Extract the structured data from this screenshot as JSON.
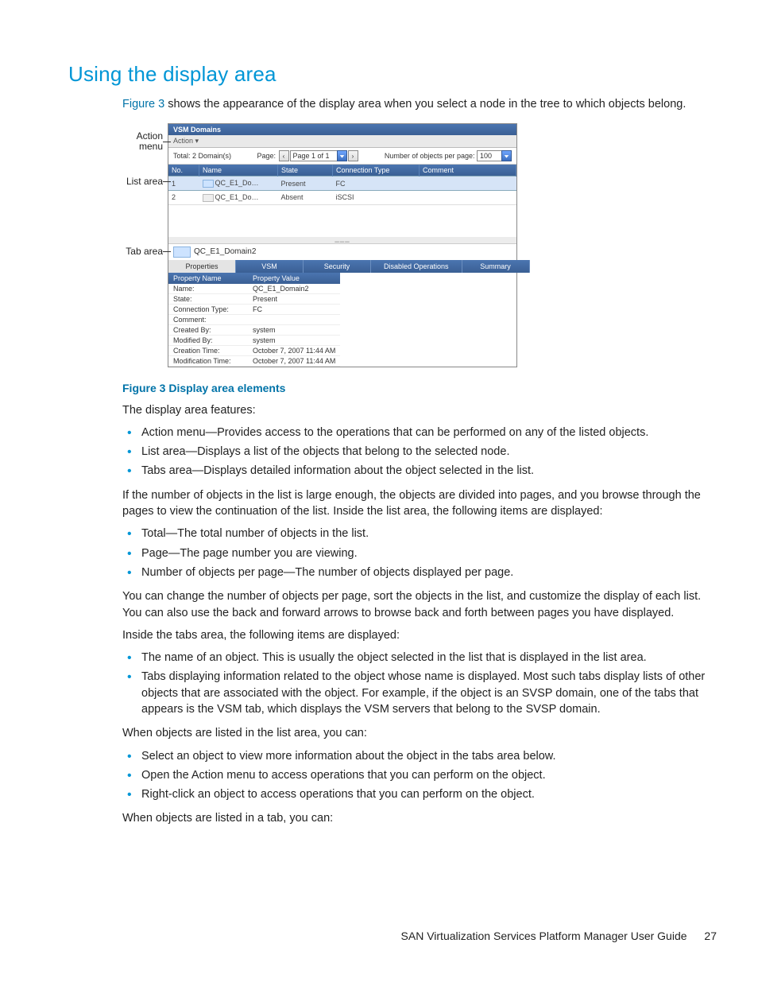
{
  "section_title": "Using the display area",
  "intro_prefix": "Figure 3",
  "intro_rest": " shows the appearance of the display area when you select a node in the tree to which objects belong.",
  "callouts": {
    "action": "Action menu",
    "list": "List area",
    "tab": "Tab area"
  },
  "screenshot": {
    "title": "VSM Domains",
    "action_label": "Action ▾",
    "total_label": "Total: 2 Domain(s)",
    "page_label": "Page:",
    "page_value": "Page 1 of 1",
    "perpage_label": "Number of objects per page:",
    "perpage_value": "100",
    "columns": [
      "No.",
      "Name",
      "State",
      "Connection Type",
      "Comment"
    ],
    "rows": [
      {
        "no": "1",
        "name": "QC_E1_Do…",
        "state": "Present",
        "conn": "FC",
        "comment": ""
      },
      {
        "no": "2",
        "name": "QC_E1_Do…",
        "state": "Absent",
        "conn": "iSCSI",
        "comment": ""
      }
    ],
    "detail_name": "QC_E1_Domain2",
    "tabs": [
      "Properties",
      "VSM",
      "Security",
      "Disabled Operations",
      "Summary"
    ],
    "prop_headers": [
      "Property Name",
      "Property Value"
    ],
    "properties": [
      {
        "k": "Name:",
        "v": "QC_E1_Domain2"
      },
      {
        "k": "State:",
        "v": "Present"
      },
      {
        "k": "Connection Type:",
        "v": "FC"
      },
      {
        "k": "Comment:",
        "v": ""
      },
      {
        "k": "Created By:",
        "v": "system"
      },
      {
        "k": "Modified By:",
        "v": "system"
      },
      {
        "k": "Creation Time:",
        "v": "October 7, 2007 11:44 AM"
      },
      {
        "k": "Modification Time:",
        "v": "October 7, 2007 11:44 AM"
      }
    ]
  },
  "figure_caption": "Figure 3 Display area elements",
  "para_features": "The display area features:",
  "feature_bullets": [
    "Action menu—Provides access to the operations that can be performed on any of the listed objects.",
    "List area—Displays a list of the objects that belong to the selected node.",
    "Tabs area—Displays detailed information about the object selected in the list."
  ],
  "para_pages": "If the number of objects in the list is large enough, the objects are divided into pages, and you browse through the pages to view the continuation of the list. Inside the list area, the following items are displayed:",
  "listarea_bullets": [
    "Total—The total number of objects in the list.",
    "Page—The page number you are viewing.",
    "Number of objects per page—The number of objects displayed per page."
  ],
  "para_change": "You can change the number of objects per page, sort the objects in the list, and customize the display of each list. You can also use the back and forward arrows to browse back and forth between pages you have displayed.",
  "para_tabs_intro": "Inside the tabs area, the following items are displayed:",
  "tabs_bullets": [
    "The name of an object. This is usually the object selected in the list that is displayed in the list area.",
    "Tabs displaying information related to the object whose name is displayed. Most such tabs display lists of other objects that are associated with the object. For example, if the object is an SVSP domain, one of the tabs that appears is the VSM tab, which displays the VSM servers that belong to the SVSP domain."
  ],
  "para_listed_list": "When objects are listed in the list area, you can:",
  "list_actions": [
    "Select an object to view more information about the object in the tabs area below.",
    "Open the Action menu to access operations that you can perform on the object.",
    "Right-click an object to access operations that you can perform on the object."
  ],
  "para_listed_tab": "When objects are listed in a tab, you can:",
  "footer_title": "SAN Virtualization Services Platform Manager User Guide",
  "footer_page": "27"
}
